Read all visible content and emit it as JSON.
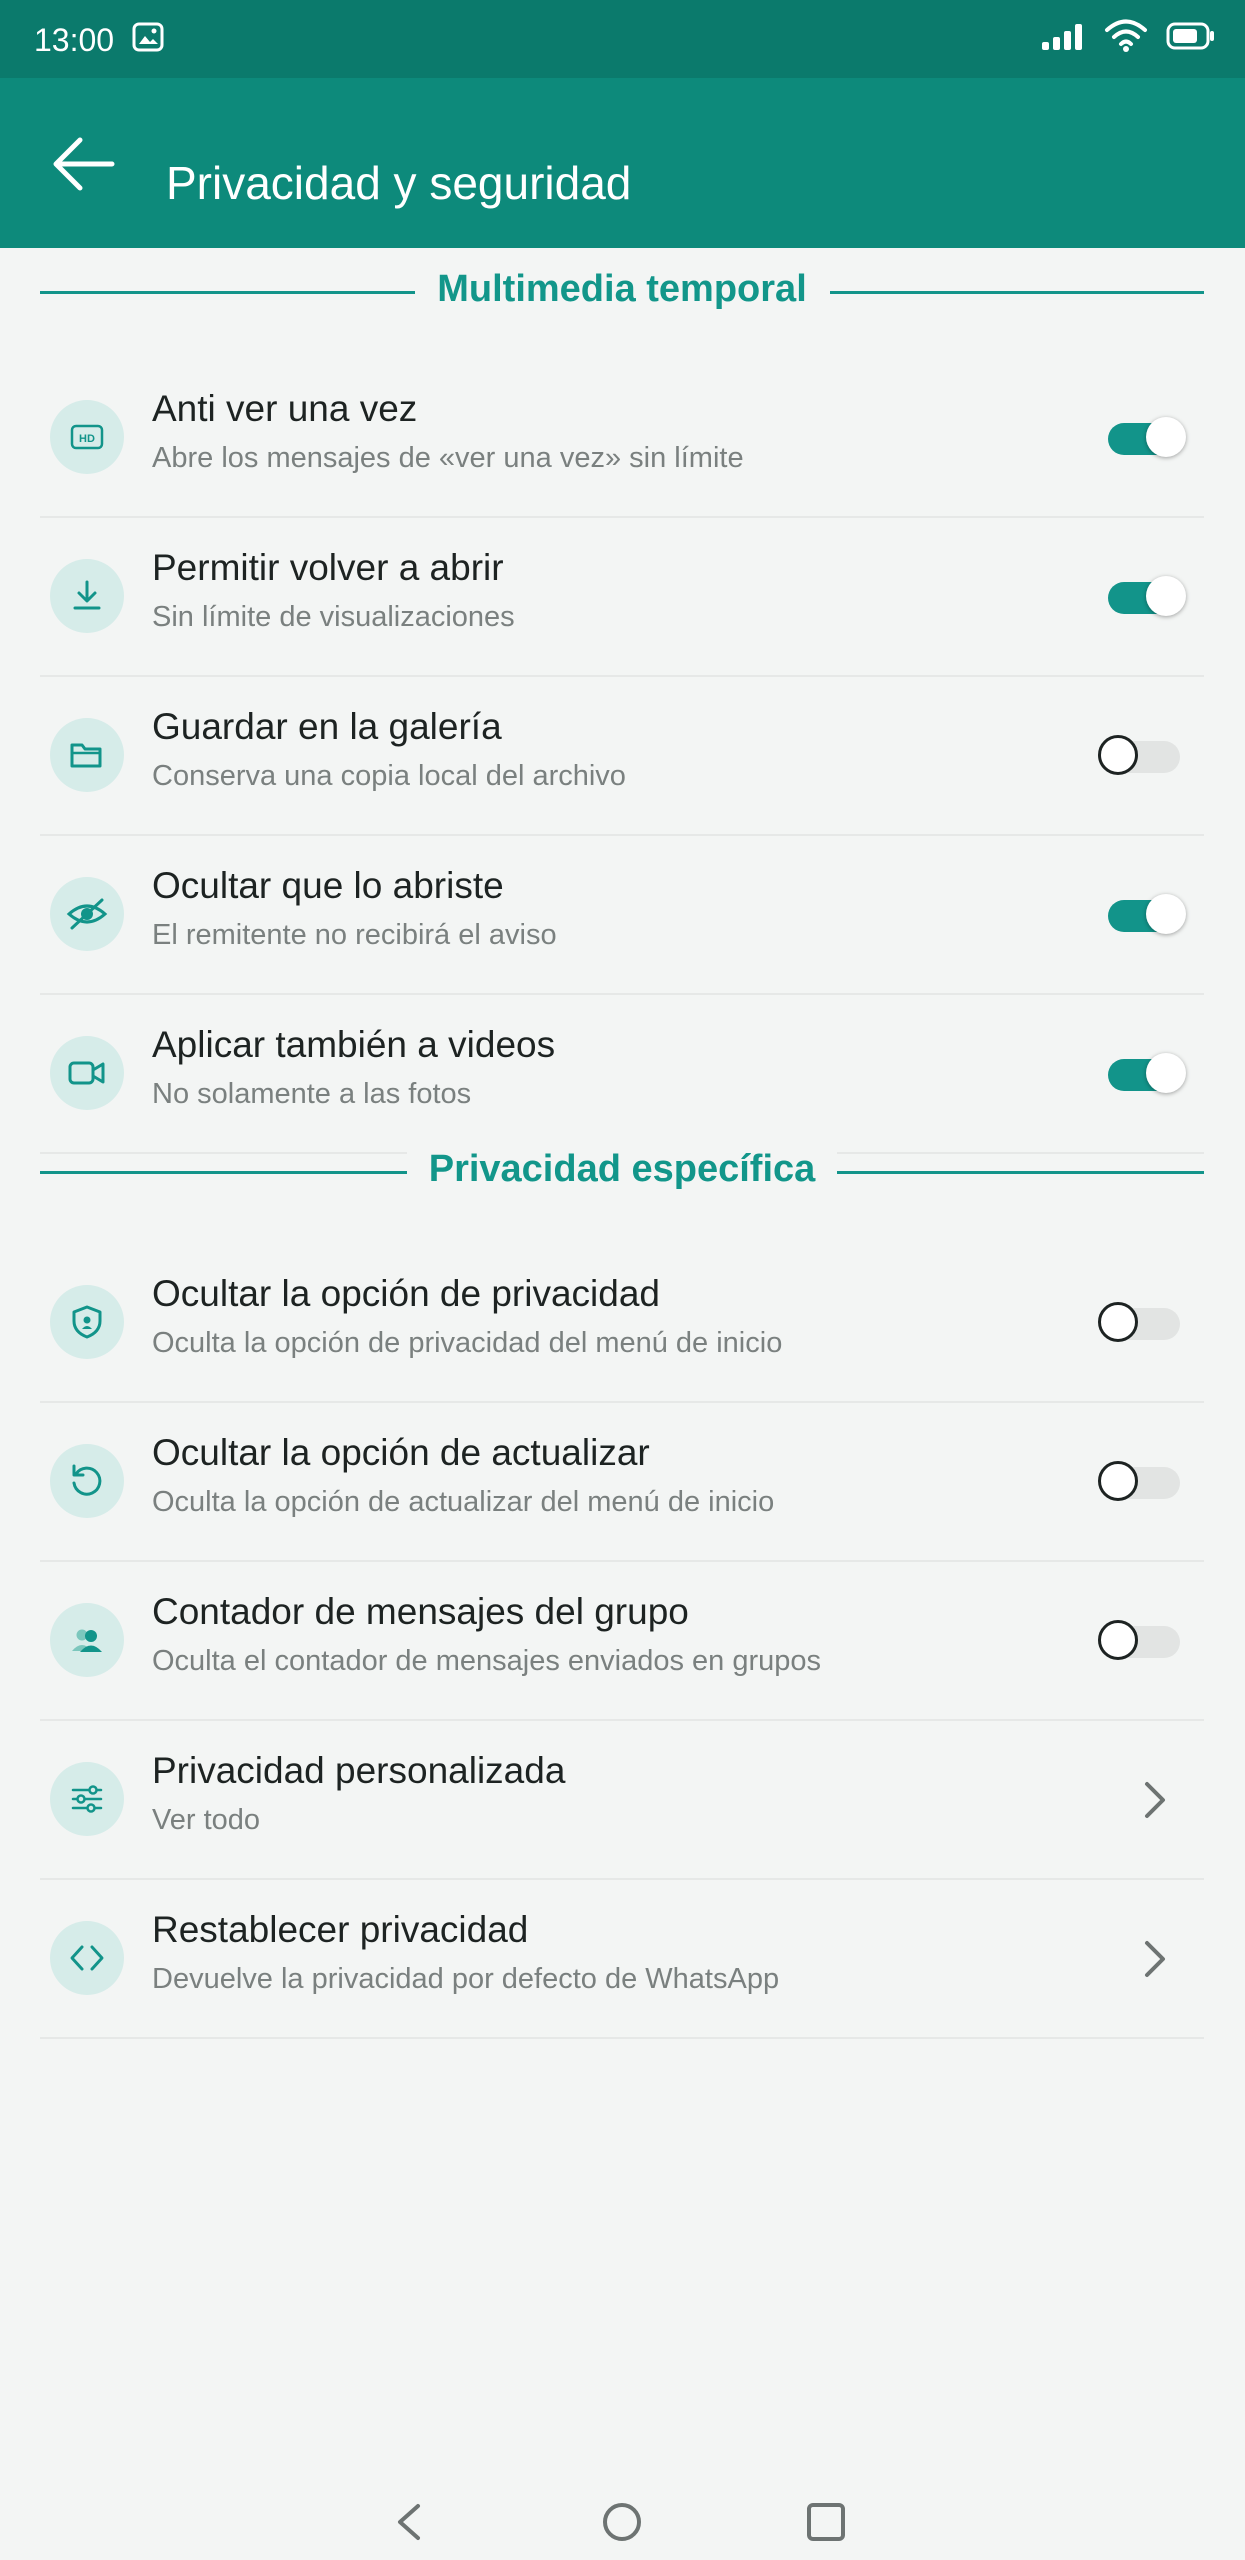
{
  "status": {
    "time": "13:00"
  },
  "header": {
    "title": "Privacidad y seguridad"
  },
  "sections": {
    "temporal": "Multimedia temporal",
    "especifica": "Privacidad específica"
  },
  "rows": [
    {
      "title": "Anti ver una vez",
      "subtitle": "Abre los mensajes de «ver una vez» sin límite",
      "icon": "hd-icon",
      "control": "toggle",
      "on": true
    },
    {
      "title": "Permitir volver a abrir",
      "subtitle": "Sin límite de visualizaciones",
      "icon": "download-icon",
      "control": "toggle",
      "on": true
    },
    {
      "title": "Guardar en la galería",
      "subtitle": "Conserva una copia local del archivo",
      "icon": "folder-icon",
      "control": "toggle",
      "on": false
    },
    {
      "title": "Ocultar que lo abriste",
      "subtitle": "El remitente no recibirá el aviso",
      "icon": "eye-off-icon",
      "control": "toggle",
      "on": true
    },
    {
      "title": "Aplicar también a videos",
      "subtitle": "No solamente a las fotos",
      "icon": "video-icon",
      "control": "toggle",
      "on": true
    },
    {
      "title": "Ocultar la opción de privacidad",
      "subtitle": "Oculta la opción de privacidad del menú de inicio",
      "icon": "shield-icon",
      "control": "toggle",
      "on": false
    },
    {
      "title": "Ocultar la opción de actualizar",
      "subtitle": "Oculta la opción de actualizar del menú de inicio",
      "icon": "refresh-icon",
      "control": "toggle",
      "on": false
    },
    {
      "title": "Contador de mensajes del grupo",
      "subtitle": "Oculta el contador de mensajes enviados en grupos",
      "icon": "group-icon",
      "control": "toggle",
      "on": false
    },
    {
      "title": "Privacidad personalizada",
      "subtitle": "Ver todo",
      "icon": "sliders-icon",
      "control": "chevron"
    },
    {
      "title": "Restablecer privacidad",
      "subtitle": "Devuelve la privacidad por defecto de WhatsApp",
      "icon": "code-icon",
      "control": "chevron"
    }
  ],
  "colors": {
    "accent": "#12948a",
    "appbar": "#0d8a7b",
    "statusbar": "#0b7a6c"
  }
}
